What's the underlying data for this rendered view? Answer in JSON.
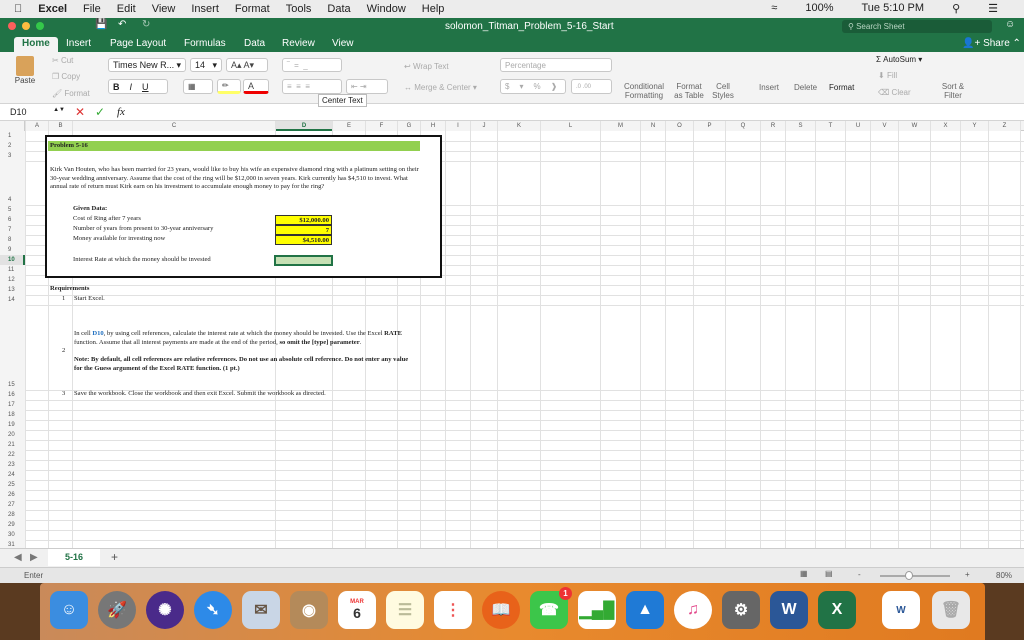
{
  "menubar": {
    "items": [
      "Excel",
      "File",
      "Edit",
      "View",
      "Insert",
      "Format",
      "Tools",
      "Data",
      "Window",
      "Help"
    ],
    "battery": "100%",
    "clock": "Tue 5:10 PM"
  },
  "window": {
    "title": "solomon_Titman_Problem_5-16_Start",
    "search_placeholder": "Search Sheet",
    "share": "Share"
  },
  "ribbon_tabs": [
    "Home",
    "Insert",
    "Page Layout",
    "Formulas",
    "Data",
    "Review",
    "View"
  ],
  "ribbon": {
    "paste": "Paste",
    "cut": "Cut",
    "copy": "Copy",
    "format": "Format",
    "font": "Times New R...",
    "size": "14",
    "bold": "B",
    "italic": "I",
    "underline": "U",
    "wrap": "Wrap Text",
    "merge": "Merge & Center",
    "number_format": "Percentage",
    "currency": "$",
    "percent": "%",
    "cond": "Conditional Formatting",
    "fmt_table": "Format as Table",
    "cell_styles": "Cell Styles",
    "insert": "Insert",
    "delete": "Delete",
    "format_cells": "Format",
    "autosum": "AutoSum",
    "fill": "Fill",
    "clear": "Clear",
    "sort": "Sort & Filter",
    "tooltip": "Center Text"
  },
  "formula_bar": {
    "name_box": "D10",
    "fx": "fx",
    "value": ""
  },
  "columns": [
    "A",
    "B",
    "C",
    "D",
    "E",
    "F",
    "G",
    "H",
    "I",
    "J",
    "K",
    "L",
    "M",
    "N",
    "O",
    "P",
    "Q",
    "R",
    "S",
    "T",
    "U",
    "V",
    "W",
    "X",
    "Y",
    "Z"
  ],
  "rows": [
    "1",
    "2",
    "3",
    "4",
    "5",
    "6",
    "7",
    "8",
    "9",
    "10",
    "11",
    "12",
    "13",
    "14",
    "15",
    "16",
    "17",
    "18",
    "19",
    "20",
    "21",
    "22",
    "23",
    "24",
    "25",
    "26",
    "27",
    "28",
    "29",
    "30",
    "31"
  ],
  "sheet": {
    "title": "Problem 5-16",
    "problem": "Kirk Van Houten, who has been married for 23 years, would like to buy his wife an expensive diamond ring with a platinum setting on their 30-year wedding anniversary. Assume that the cost of the ring will be $12,000 in seven years. Kirk currently has $4,510 to invest. What annual rate of return must Kirk earn on his investment to accumulate enough money to pay for the ring?",
    "given_label": "Given Data:",
    "given": [
      {
        "label": "Cost of Ring after 7 years",
        "value": "$12,000.00"
      },
      {
        "label": "Number of years from present to 30-year anniversary",
        "value": "7"
      },
      {
        "label": "Money available for investing now",
        "value": "$4,510.00"
      }
    ],
    "result_label": "Interest Rate at which the money should be invested",
    "result_value": "",
    "req_title": "Requirements",
    "req": [
      {
        "n": "1",
        "text": "Start Excel."
      },
      {
        "n": "2",
        "p1": "In cell ",
        "ref": "D10",
        "p2": ", by using cell references, calculate the interest rate at which the money should be invested. Use the Excel ",
        "rate": "RATE",
        "p3": " function. Assume that all interest payments are made at the end of the period, ",
        "bold": "so omit the [type] parameter",
        "p4": ".",
        "note": "Note: By default, all cell references are relative references. Do not use an absolute cell reference. Do not enter any value for the Guess argument of the Excel RATE function. (1 pt.)"
      },
      {
        "n": "3",
        "text": "Save the workbook. Close the workbook and then exit Excel. Submit the workbook as directed."
      }
    ]
  },
  "sheet_tab": "5-16",
  "status": {
    "mode": "Enter",
    "zoom": "80%",
    "zoom_fraction": 0.4
  },
  "dock": {
    "calendar_month": "MAR",
    "calendar_day": "6",
    "facetime_badge": "1"
  },
  "colors": {
    "excel_green": "#217346",
    "title_fill": "#92d050",
    "input_fill": "#ffff00",
    "result_fill": "#c6e0b4"
  }
}
